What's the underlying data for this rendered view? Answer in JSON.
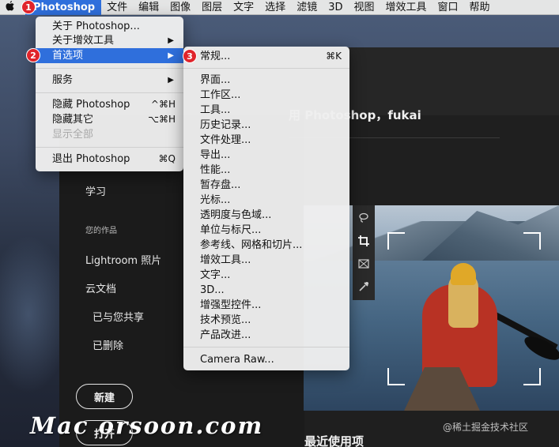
{
  "menubar": {
    "apple_icon": "apple-logo-icon",
    "app_name": "Photoshop",
    "items": [
      "文件",
      "编辑",
      "图像",
      "图层",
      "文字",
      "选择",
      "滤镜",
      "3D",
      "视图",
      "增效工具",
      "窗口",
      "帮助"
    ]
  },
  "app_menu": {
    "about_ps": "关于 Photoshop...",
    "about_plugins": "关于增效工具",
    "preferences": "首选项",
    "services": "服务",
    "hide_ps": "隐藏 Photoshop",
    "hide_ps_shortcut": "^⌘H",
    "hide_others": "隐藏其它",
    "hide_others_shortcut": "⌥⌘H",
    "show_all": "显示全部",
    "quit": "退出 Photoshop",
    "quit_shortcut": "⌘Q",
    "arrow": "▶"
  },
  "prefs_menu": {
    "general": "常规...",
    "general_shortcut": "⌘K",
    "items": [
      "界面...",
      "工作区...",
      "工具...",
      "历史记录...",
      "文件处理...",
      "导出...",
      "性能...",
      "暂存盘...",
      "光标...",
      "透明度与色域...",
      "单位与标尺...",
      "参考线、网格和切片...",
      "增效工具...",
      "文字...",
      "3D...",
      "增强型控件...",
      "技术预览...",
      "产品改进..."
    ],
    "camera_raw": "Camera Raw..."
  },
  "badges": [
    "1",
    "2",
    "3"
  ],
  "home": {
    "welcome": "用 Photoshop，fukai",
    "learn": "学习",
    "your_work": "您的作品",
    "lightroom": "Lightroom 照片",
    "cloud_docs": "云文档",
    "shared": "已与您共享",
    "deleted": "已删除",
    "new_button": "新建",
    "open_button": "打开",
    "recent": "最近使用项"
  },
  "overlay": {
    "watermark": "Mac orsoon.com",
    "credit": "@稀土掘金技术社区"
  },
  "colors": {
    "highlight": "#2f6fdc",
    "badge": "#e0242b",
    "menu_bg": "#eeeeee",
    "app_bg": "#1f1f1f"
  }
}
